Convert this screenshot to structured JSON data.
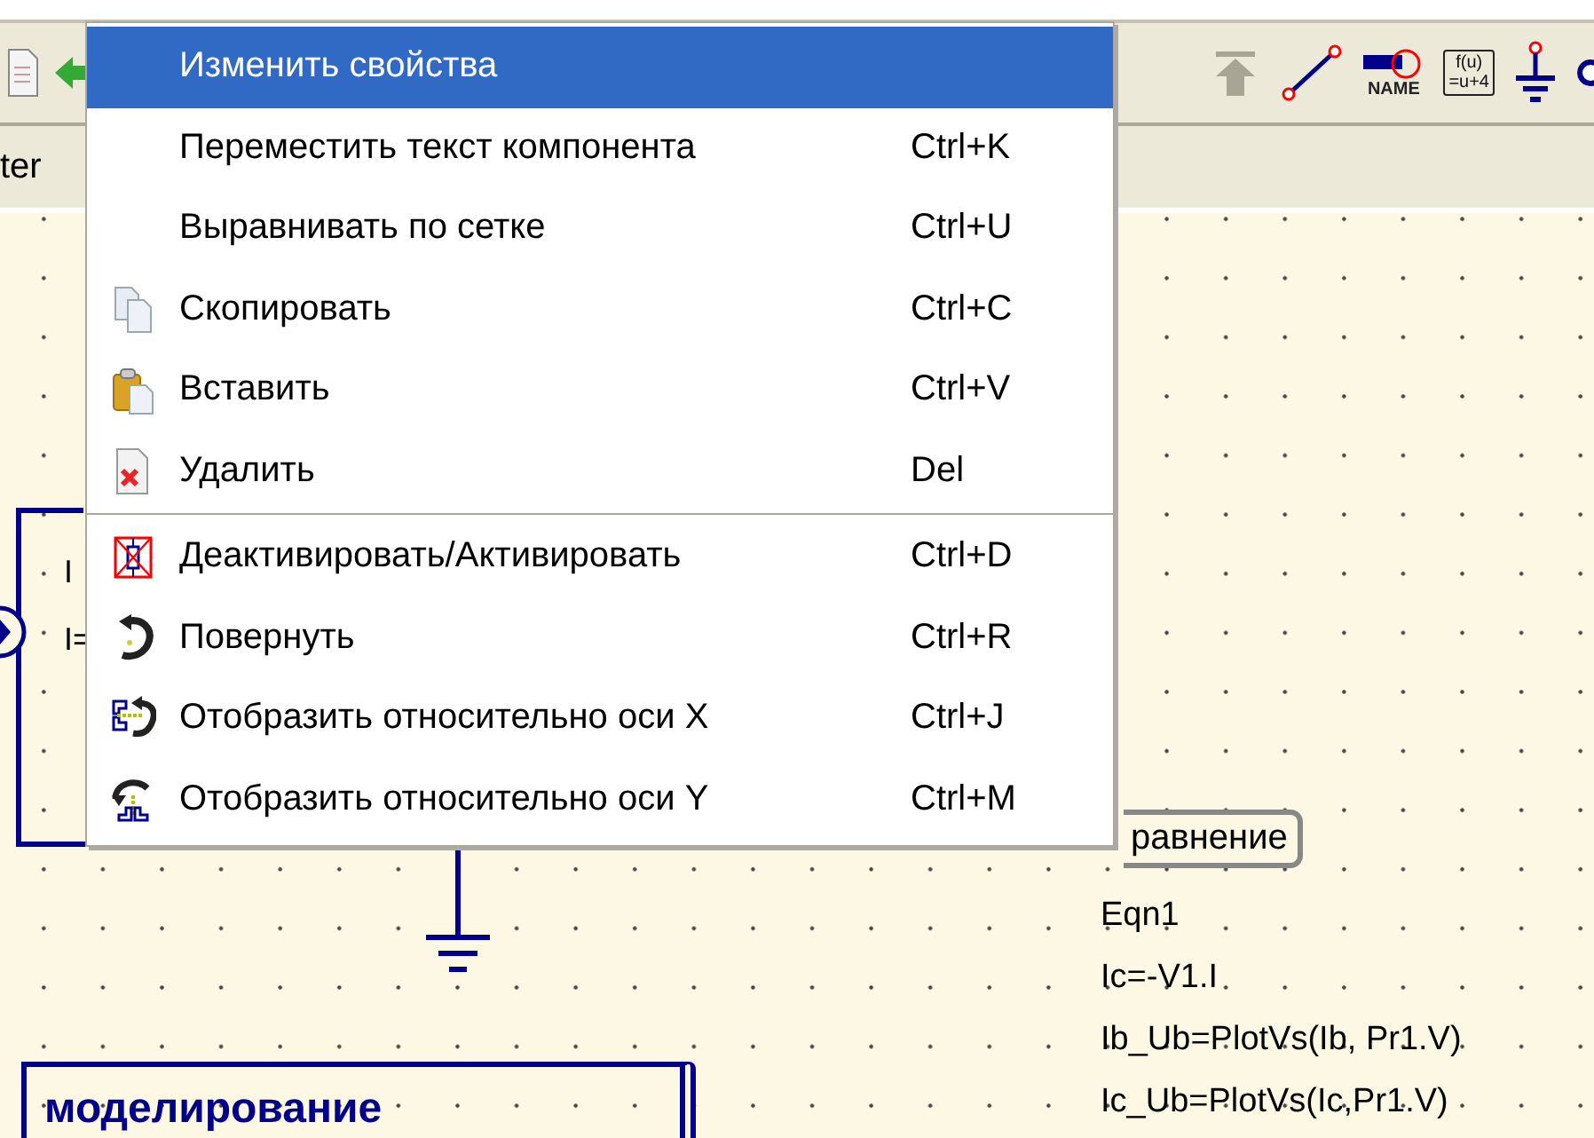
{
  "toolbar": {
    "left_text": "ter",
    "icons": [
      {
        "kind": "document"
      },
      {
        "kind": "green-arrow"
      },
      {
        "kind": "grey-arrow"
      },
      {
        "kind": "wire"
      },
      {
        "kind": "label",
        "text": "NAME"
      },
      {
        "kind": "equation",
        "lines": [
          "f(u)",
          "=u+4"
        ]
      },
      {
        "kind": "ground"
      },
      {
        "kind": "port"
      }
    ]
  },
  "context_menu": {
    "sections": [
      {
        "items": [
          {
            "label": "Изменить свойства",
            "selected": true
          },
          {
            "label": "Переместить текст компонента",
            "shortcut": "Ctrl+K",
            "selected": false
          },
          {
            "label": "Выравнивать по сетке",
            "shortcut": "Ctrl+U",
            "selected": false
          },
          {
            "label": "Скопировать",
            "shortcut": "Ctrl+C",
            "kind": "copy",
            "selected": false
          },
          {
            "label": "Вставить",
            "shortcut": "Ctrl+V",
            "kind": "paste",
            "selected": false
          },
          {
            "label": "Удалить",
            "shortcut": "Del",
            "kind": "delete",
            "selected": false
          }
        ]
      },
      {
        "items": [
          {
            "label": "Деактивировать/Активировать",
            "shortcut": "Ctrl+D",
            "kind": "deactivate",
            "selected": false
          },
          {
            "label": "Повернуть",
            "shortcut": "Ctrl+R",
            "kind": "rotate",
            "selected": false
          },
          {
            "label": "Отобразить относительно оси X",
            "shortcut": "Ctrl+J",
            "kind": "mirror-x",
            "selected": false
          },
          {
            "label": "Отобразить относительно оси Y",
            "shortcut": "Ctrl+M",
            "kind": "mirror-y",
            "selected": false
          }
        ]
      }
    ]
  },
  "schematic": {
    "component_labels": [
      "I",
      "I="
    ],
    "equation": {
      "title": "равнение",
      "lines": [
        "Eqn1",
        "Ic=-V1.I",
        "Ib_Ub=PlotVs(Ib, Pr1.V)",
        "Ic_Ub=PlotVs(Ic,Pr1.V)"
      ]
    },
    "text_box": "моделирование"
  }
}
